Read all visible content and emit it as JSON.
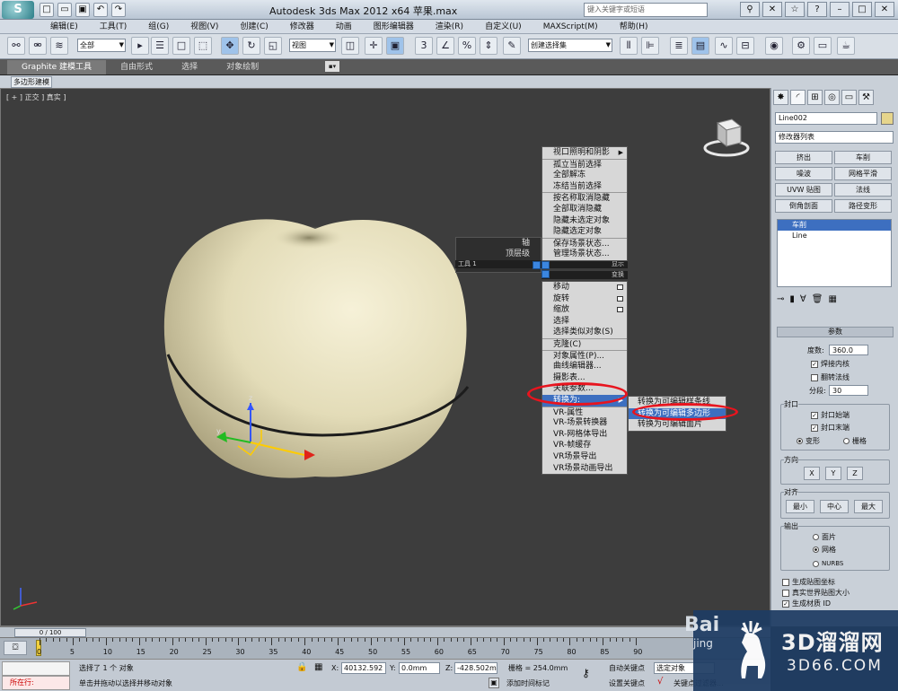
{
  "window": {
    "title": "Autodesk 3ds Max  2012 x64      苹果.max",
    "search_placeholder": "键入关键字或短语",
    "logo_label": "S"
  },
  "menubar": [
    "编辑(E)",
    "工具(T)",
    "组(G)",
    "视图(V)",
    "创建(C)",
    "修改器",
    "动画",
    "图形编辑器",
    "渲染(R)",
    "自定义(U)",
    "MAXScript(M)",
    "帮助(H)"
  ],
  "toolbar": {
    "filter_select": "全部",
    "view_select": "视图",
    "named_selection": "创建选择集",
    "snap_label": "3",
    "percent_label": "%"
  },
  "ribbon": {
    "tabs": [
      "Graphite 建模工具",
      "自由形式",
      "选择",
      "对象绘制"
    ],
    "sub_label": "多边形建模"
  },
  "viewport": {
    "label": "[ + ] 正交 ] 真实 ]",
    "gizmo_axes": {
      "x": "x",
      "y": "y",
      "z": "z"
    }
  },
  "quad_menu": {
    "left_items": [
      "轴",
      "顶层级"
    ],
    "tools_header_left": "工具 1",
    "display_header": "显示",
    "transform_header": "变换",
    "display_items": [
      "视口照明和阴影",
      "孤立当前选择",
      "全部解冻",
      "冻结当前选择",
      "按名称取消隐藏",
      "全部取消隐藏",
      "隐藏未选定对象",
      "隐藏选定对象",
      "保存场景状态...",
      "管理场景状态..."
    ],
    "transform_items": [
      "移动",
      "旋转",
      "缩放",
      "选择",
      "选择类似对象(S)",
      "克隆(C)",
      "对象属性(P)...",
      "曲线编辑器...",
      "摄影表...",
      "关联参数...",
      "转换为:",
      "VR-属性",
      "VR-场景转换器",
      "VR-网格体导出",
      "VR-帧缓存",
      "VR场景导出",
      "VR场景动画导出"
    ],
    "submenu": [
      "转换为可编辑样条线",
      "转换为可编辑多边形",
      "转换为可编辑面片"
    ]
  },
  "command_panel": {
    "object_name": "Line002",
    "modifier_list": "修改器列表",
    "modifier_buttons": [
      "挤出",
      "车削",
      "噪波",
      "网格平滑",
      "UVW 贴图",
      "法线",
      "倒角剖面",
      "路径变形"
    ],
    "stack": [
      "车削",
      "Line"
    ],
    "params_header": "参数",
    "degrees_label": "度数:",
    "degrees_value": "360.0",
    "weld_core": "焊接内核",
    "flip_normals": "翻转法线",
    "segments_label": "分段:",
    "segments_value": "30",
    "capping_label": "封口",
    "cap_start": "封口始端",
    "cap_end": "封口末端",
    "morph": "变形",
    "grid": "栅格",
    "direction_label": "方向",
    "dir_x": "X",
    "dir_y": "Y",
    "dir_z": "Z",
    "align_label": "对齐",
    "align_min": "最小",
    "align_center": "中心",
    "align_max": "最大",
    "output_label": "输出",
    "out_patch": "面片",
    "out_mesh": "网格",
    "out_nurbs": "NURBS",
    "gen_map": "生成贴图坐标",
    "real_world": "真实世界贴图大小",
    "gen_mat": "生成材质 ID"
  },
  "timeline": {
    "slider_label": "0 / 100",
    "ticks": [
      "0",
      "5",
      "10",
      "15",
      "20",
      "25",
      "30",
      "35",
      "40",
      "45",
      "50",
      "55",
      "60",
      "65",
      "70",
      "75",
      "80",
      "85",
      "90"
    ]
  },
  "status": {
    "mode_label": "所在行:",
    "selection_text": "选择了 1 个 对象",
    "prompt_text": "单击并拖动以选择并移动对象",
    "x_label": "X:",
    "x_value": "40132.592",
    "y_label": "Y:",
    "y_value": "0.0mm",
    "z_label": "Z:",
    "z_value": "-428.502m",
    "grid_text": "栅格 = 254.0mm",
    "add_time_tag": "添加时间标记",
    "auto_key": "自动关键点",
    "set_key": "设置关键点",
    "selected_object": "选定对象",
    "key_filter": "关键点过滤器..."
  },
  "watermark": {
    "title": "3D溜溜网",
    "url": "3D66.COM",
    "baidu": "Bai",
    "baidu2": "jing"
  },
  "colors": {
    "highlight": "#3d6fc0",
    "annotation_ring": "#e8141e",
    "apple": "#e3dcb8"
  }
}
